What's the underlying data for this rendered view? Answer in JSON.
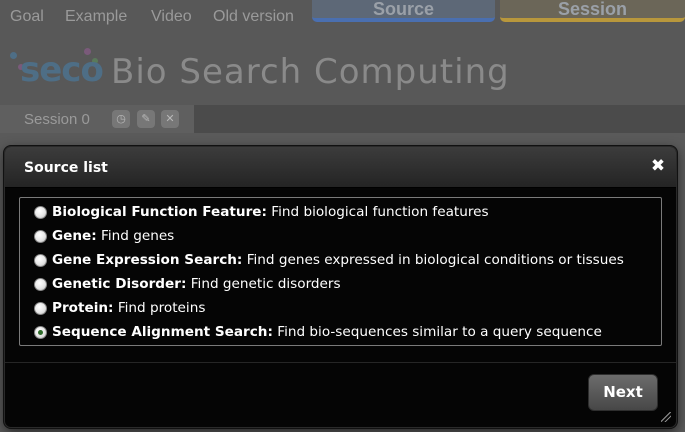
{
  "nav": {
    "links": [
      "Goal",
      "Example",
      "Video",
      "Old version"
    ]
  },
  "top_tabs": {
    "source": "Source",
    "session": "Session"
  },
  "header": {
    "logo_text": "seco",
    "app_title": "Bio Search Computing"
  },
  "session": {
    "label": "Session 0",
    "icons": [
      "clock-icon",
      "pencil-icon",
      "close-icon"
    ]
  },
  "dialog": {
    "title": "Source list",
    "close_symbol": "✖",
    "sources": [
      {
        "name": "Biological Function Feature:",
        "desc": " Find biological function features",
        "selected": false
      },
      {
        "name": "Gene:",
        "desc": " Find genes",
        "selected": false
      },
      {
        "name": "Gene Expression Search:",
        "desc": " Find genes expressed in biological conditions or tissues",
        "selected": false
      },
      {
        "name": "Genetic Disorder:",
        "desc": " Find genetic disorders",
        "selected": false
      },
      {
        "name": "Protein:",
        "desc": " Find proteins",
        "selected": false
      },
      {
        "name": "Sequence Alignment Search:",
        "desc": " Find bio-sequences similar to a query sequence",
        "selected": true
      }
    ],
    "next_label": "Next"
  },
  "colors": {
    "source_tab_accent": "#4a6fb0",
    "session_tab_accent": "#b8973c",
    "selected_radio": "#2e6b2a"
  }
}
